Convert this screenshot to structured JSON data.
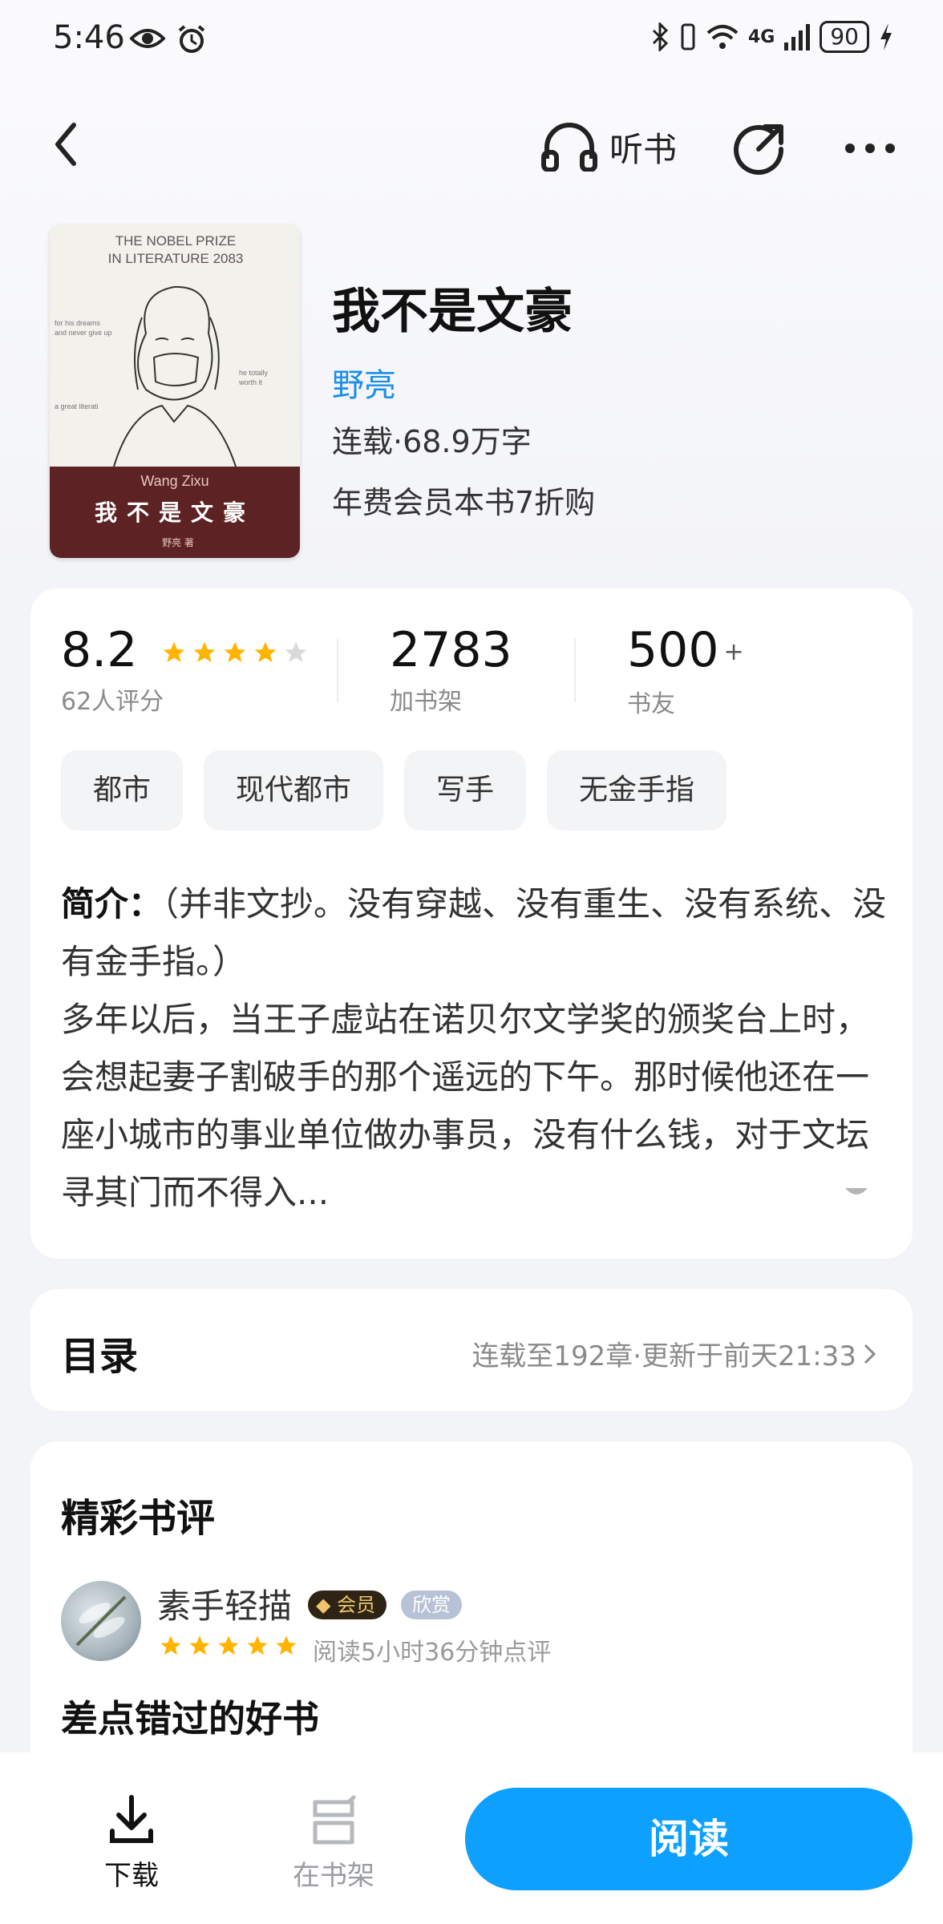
{
  "status_bar": {
    "time": "5:46",
    "battery": "90",
    "network": "4G"
  },
  "nav": {
    "listen_label": "听书"
  },
  "book": {
    "title": "我不是文豪",
    "author": "野亮",
    "meta": "连载·68.9万字",
    "vip_offer": "年费会员本书7折购",
    "cover": {
      "prize_line1": "THE NOBEL PRIZE",
      "prize_line2": "IN LITERATURE 2083",
      "author_en": "Wang Zixu",
      "title_cn": "我不是文豪",
      "author_cn": "野亮 著",
      "side_left1": "for his dreams",
      "side_left2": "and never give up",
      "side_right1": "he totally",
      "side_right2": "worth it",
      "side_left3": "a great literati"
    }
  },
  "stats": {
    "rating": "8.2",
    "rating_label": "62人评分",
    "rating_stars": 4.5,
    "shelf_count": "2783",
    "shelf_label": "加书架",
    "friends_count": "500",
    "friends_plus": "+",
    "friends_label": "书友"
  },
  "tags": [
    "都市",
    "现代都市",
    "写手",
    "无金手指"
  ],
  "intro": {
    "label": "简介：",
    "text1": "（并非文抄。没有穿越、没有重生、没有系统、没有金手指。）",
    "text2": "多年以后，当王子虚站在诺贝尔文学奖的颁奖台上时，会想起妻子割破手的那个遥远的下午。那时候他还在一座小城市的事业单位做办事员，没有什么钱，对于文坛寻其门而不得入..."
  },
  "toc": {
    "title": "目录",
    "info": "连载至192章·更新于前天21:33"
  },
  "reviews": {
    "title": "精彩书评",
    "items": [
      {
        "name": "素手轻描",
        "vip_badge": "会员",
        "like_badge": "欣赏",
        "stars": 5,
        "meta": "阅读5小时36分钟点评",
        "headline": "差点错过的好书"
      }
    ]
  },
  "bottom_bar": {
    "download_label": "下载",
    "shelf_label": "在书架",
    "read_label": "阅读"
  },
  "colors": {
    "accent": "#0ea0ff",
    "author_link": "#1a8ee6",
    "star": "#ffb400",
    "star_empty": "#d9d9d9"
  }
}
